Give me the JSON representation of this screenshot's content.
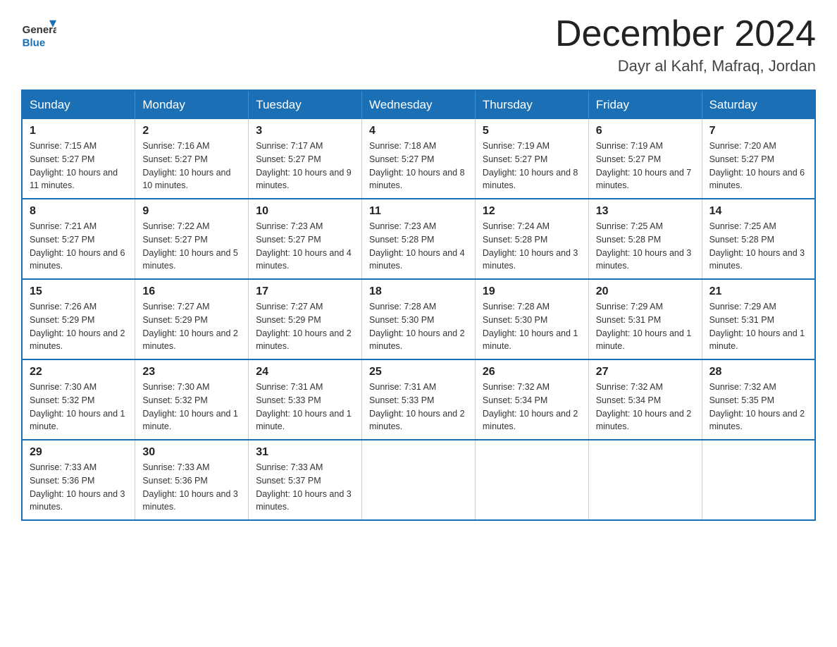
{
  "header": {
    "logo_general": "General",
    "logo_blue": "Blue",
    "month_title": "December 2024",
    "location": "Dayr al Kahf, Mafraq, Jordan"
  },
  "days_of_week": [
    "Sunday",
    "Monday",
    "Tuesday",
    "Wednesday",
    "Thursday",
    "Friday",
    "Saturday"
  ],
  "weeks": [
    [
      {
        "day": "1",
        "sunrise": "7:15 AM",
        "sunset": "5:27 PM",
        "daylight": "10 hours and 11 minutes."
      },
      {
        "day": "2",
        "sunrise": "7:16 AM",
        "sunset": "5:27 PM",
        "daylight": "10 hours and 10 minutes."
      },
      {
        "day": "3",
        "sunrise": "7:17 AM",
        "sunset": "5:27 PM",
        "daylight": "10 hours and 9 minutes."
      },
      {
        "day": "4",
        "sunrise": "7:18 AM",
        "sunset": "5:27 PM",
        "daylight": "10 hours and 8 minutes."
      },
      {
        "day": "5",
        "sunrise": "7:19 AM",
        "sunset": "5:27 PM",
        "daylight": "10 hours and 8 minutes."
      },
      {
        "day": "6",
        "sunrise": "7:19 AM",
        "sunset": "5:27 PM",
        "daylight": "10 hours and 7 minutes."
      },
      {
        "day": "7",
        "sunrise": "7:20 AM",
        "sunset": "5:27 PM",
        "daylight": "10 hours and 6 minutes."
      }
    ],
    [
      {
        "day": "8",
        "sunrise": "7:21 AM",
        "sunset": "5:27 PM",
        "daylight": "10 hours and 6 minutes."
      },
      {
        "day": "9",
        "sunrise": "7:22 AM",
        "sunset": "5:27 PM",
        "daylight": "10 hours and 5 minutes."
      },
      {
        "day": "10",
        "sunrise": "7:23 AM",
        "sunset": "5:27 PM",
        "daylight": "10 hours and 4 minutes."
      },
      {
        "day": "11",
        "sunrise": "7:23 AM",
        "sunset": "5:28 PM",
        "daylight": "10 hours and 4 minutes."
      },
      {
        "day": "12",
        "sunrise": "7:24 AM",
        "sunset": "5:28 PM",
        "daylight": "10 hours and 3 minutes."
      },
      {
        "day": "13",
        "sunrise": "7:25 AM",
        "sunset": "5:28 PM",
        "daylight": "10 hours and 3 minutes."
      },
      {
        "day": "14",
        "sunrise": "7:25 AM",
        "sunset": "5:28 PM",
        "daylight": "10 hours and 3 minutes."
      }
    ],
    [
      {
        "day": "15",
        "sunrise": "7:26 AM",
        "sunset": "5:29 PM",
        "daylight": "10 hours and 2 minutes."
      },
      {
        "day": "16",
        "sunrise": "7:27 AM",
        "sunset": "5:29 PM",
        "daylight": "10 hours and 2 minutes."
      },
      {
        "day": "17",
        "sunrise": "7:27 AM",
        "sunset": "5:29 PM",
        "daylight": "10 hours and 2 minutes."
      },
      {
        "day": "18",
        "sunrise": "7:28 AM",
        "sunset": "5:30 PM",
        "daylight": "10 hours and 2 minutes."
      },
      {
        "day": "19",
        "sunrise": "7:28 AM",
        "sunset": "5:30 PM",
        "daylight": "10 hours and 1 minute."
      },
      {
        "day": "20",
        "sunrise": "7:29 AM",
        "sunset": "5:31 PM",
        "daylight": "10 hours and 1 minute."
      },
      {
        "day": "21",
        "sunrise": "7:29 AM",
        "sunset": "5:31 PM",
        "daylight": "10 hours and 1 minute."
      }
    ],
    [
      {
        "day": "22",
        "sunrise": "7:30 AM",
        "sunset": "5:32 PM",
        "daylight": "10 hours and 1 minute."
      },
      {
        "day": "23",
        "sunrise": "7:30 AM",
        "sunset": "5:32 PM",
        "daylight": "10 hours and 1 minute."
      },
      {
        "day": "24",
        "sunrise": "7:31 AM",
        "sunset": "5:33 PM",
        "daylight": "10 hours and 1 minute."
      },
      {
        "day": "25",
        "sunrise": "7:31 AM",
        "sunset": "5:33 PM",
        "daylight": "10 hours and 2 minutes."
      },
      {
        "day": "26",
        "sunrise": "7:32 AM",
        "sunset": "5:34 PM",
        "daylight": "10 hours and 2 minutes."
      },
      {
        "day": "27",
        "sunrise": "7:32 AM",
        "sunset": "5:34 PM",
        "daylight": "10 hours and 2 minutes."
      },
      {
        "day": "28",
        "sunrise": "7:32 AM",
        "sunset": "5:35 PM",
        "daylight": "10 hours and 2 minutes."
      }
    ],
    [
      {
        "day": "29",
        "sunrise": "7:33 AM",
        "sunset": "5:36 PM",
        "daylight": "10 hours and 3 minutes."
      },
      {
        "day": "30",
        "sunrise": "7:33 AM",
        "sunset": "5:36 PM",
        "daylight": "10 hours and 3 minutes."
      },
      {
        "day": "31",
        "sunrise": "7:33 AM",
        "sunset": "5:37 PM",
        "daylight": "10 hours and 3 minutes."
      },
      null,
      null,
      null,
      null
    ]
  ]
}
